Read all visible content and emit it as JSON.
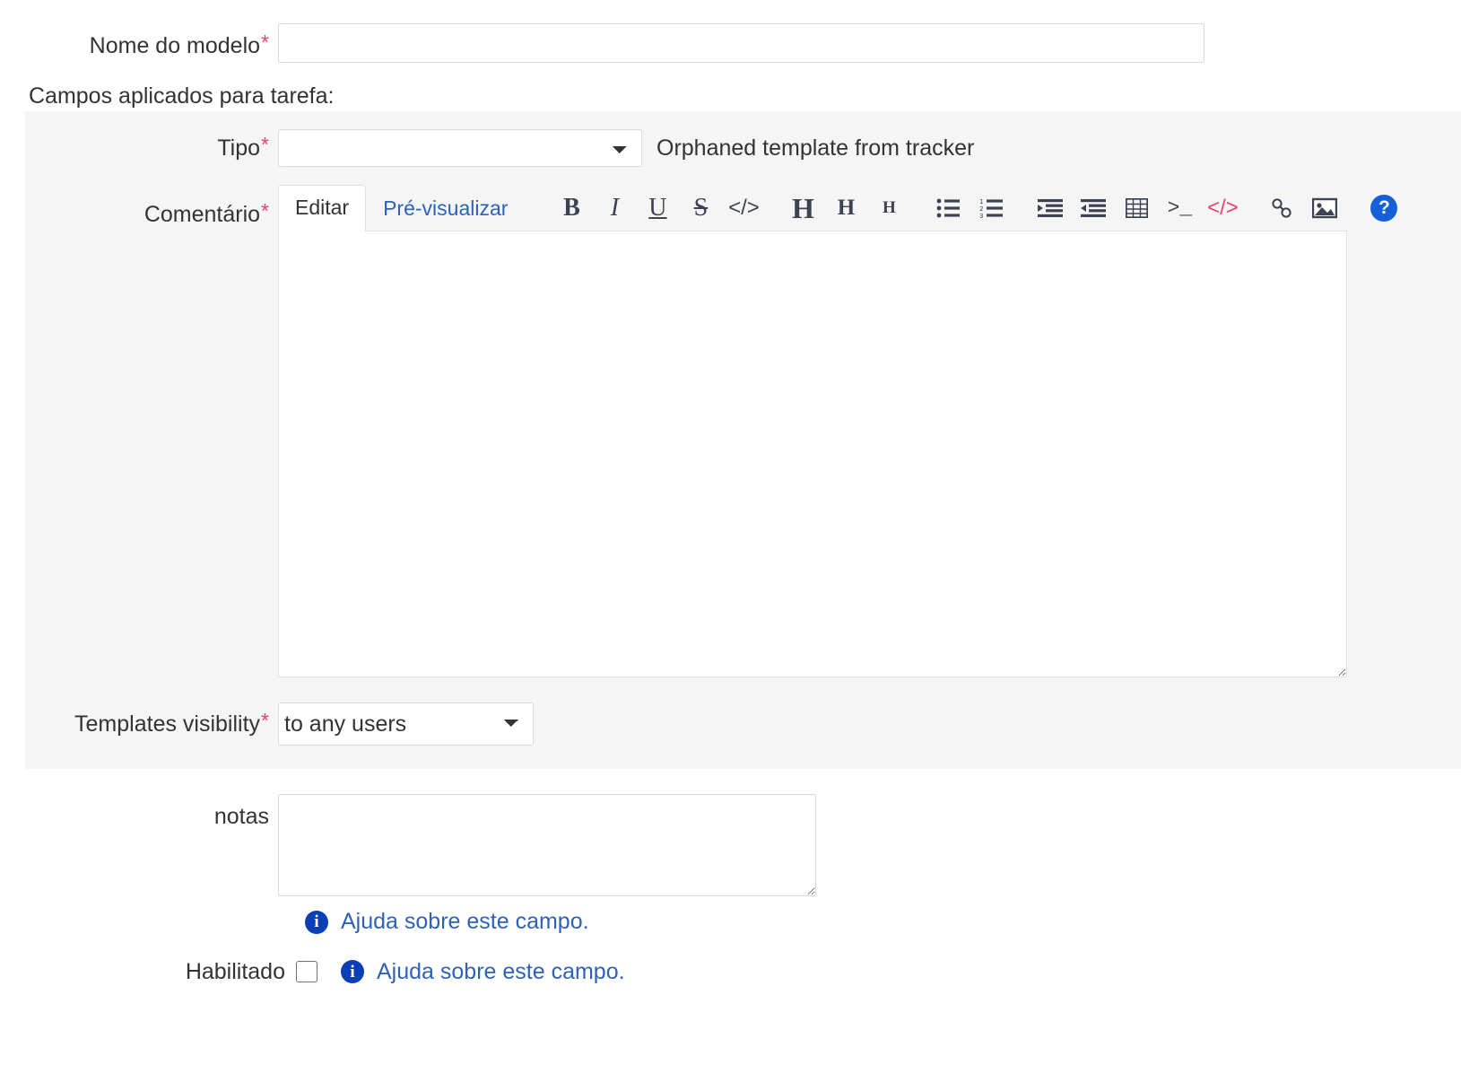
{
  "form": {
    "name_field": {
      "label": "Nome do modelo",
      "required_mark": "*",
      "value": "",
      "placeholder": ""
    },
    "fieldset_legend": "Campos aplicados para tarefa:",
    "tipo_field": {
      "label": "Tipo",
      "required_mark": "*",
      "selected": "",
      "options": [
        ""
      ],
      "note": "Orphaned template from tracker"
    },
    "comment_field": {
      "label": "Comentário",
      "required_mark": "*",
      "value": "",
      "tabs": [
        {
          "label": "Editar",
          "active": true
        },
        {
          "label": "Pré-visualizar",
          "active": false
        }
      ],
      "toolbar": [
        {
          "name": "bold-icon",
          "glyph": "B"
        },
        {
          "name": "italic-icon",
          "glyph": "I"
        },
        {
          "name": "underline-icon",
          "glyph": "U"
        },
        {
          "name": "strikethrough-icon",
          "glyph": "S"
        },
        {
          "name": "inline-code-icon",
          "glyph": "</>"
        },
        {
          "name": "heading-1-icon",
          "glyph": "H"
        },
        {
          "name": "heading-2-icon",
          "glyph": "H"
        },
        {
          "name": "heading-3-icon",
          "glyph": "H"
        },
        {
          "name": "unordered-list-icon",
          "glyph": ""
        },
        {
          "name": "ordered-list-icon",
          "glyph": ""
        },
        {
          "name": "indent-increase-icon",
          "glyph": ""
        },
        {
          "name": "indent-decrease-icon",
          "glyph": ""
        },
        {
          "name": "table-icon",
          "glyph": ""
        },
        {
          "name": "terminal-icon",
          "glyph": ">_"
        },
        {
          "name": "code-block-icon",
          "glyph": "</>"
        },
        {
          "name": "link-icon",
          "glyph": ""
        },
        {
          "name": "image-icon",
          "glyph": ""
        },
        {
          "name": "help-icon",
          "glyph": "?"
        }
      ]
    },
    "visibility_field": {
      "label": "Templates visibility",
      "required_mark": "*",
      "selected": "to any users",
      "options": [
        "to any users"
      ]
    },
    "notas_field": {
      "label": "notas",
      "value": "",
      "help_text": "Ajuda sobre este campo."
    },
    "habilitado_field": {
      "label": "Habilitado",
      "checked": false,
      "help_text": "Ajuda sobre este campo."
    }
  },
  "colors": {
    "required": "#e4436f",
    "link": "#2e62b8",
    "panel_bg": "#f5f5f5",
    "border": "#d6d9e4",
    "info_badge": "#0b3fb5",
    "help_badge": "#1560d8",
    "code_accent": "#e4436f"
  }
}
